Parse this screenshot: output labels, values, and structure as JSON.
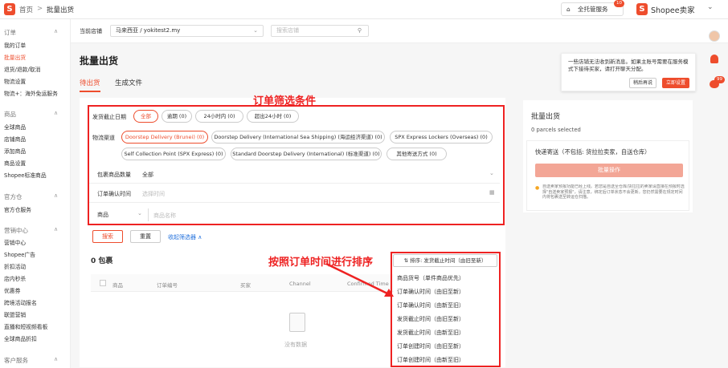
{
  "topbar": {
    "home": "首页",
    "sep": ">",
    "page": "批量出货",
    "managed": "全托管服务",
    "badge": "10",
    "seller": "Shopee卖家"
  },
  "sidebar": {
    "groups": [
      {
        "label": "订单",
        "items": [
          "我的订单",
          "批量出货",
          "退货/退款/取消",
          "物流设置",
          "物流+：海外免运服务"
        ]
      },
      {
        "label": "商品",
        "items": [
          "全球商品",
          "店铺商品",
          "添加商品",
          "商品设置",
          "Shopee标准商品"
        ]
      },
      {
        "label": "官方仓",
        "items": [
          "官方仓服务"
        ]
      },
      {
        "label": "营销中心",
        "items": [
          "营销中心",
          "Shopee广告",
          "折扣活动",
          "店内秒杀",
          "优惠券",
          "跨境活动报名",
          "联盟营销",
          "直播和短视频看板",
          "全球商品折扣"
        ]
      },
      {
        "label": "客户服务",
        "items": []
      }
    ]
  },
  "store": {
    "label": "当前店铺",
    "value": "马来西亚 / yokitest2.my",
    "search_placeholder": "搜索店铺"
  },
  "page": {
    "title": "批量出货",
    "tabs": [
      "待出货",
      "生成文件"
    ]
  },
  "filters": {
    "ship_deadline_label": "发货截止日期",
    "ship_deadline_opts": [
      "全部",
      "逾期 (0)",
      "24小时内 (0)",
      "超出24小时 (0)"
    ],
    "channel_label": "物流渠道",
    "channels_row1": [
      "Doorstep Delivery (Brunei) (0)",
      "Doorstep Delivery (International Sea Shipping) (海运经济渠道) (0)",
      "SPX Express Lockers (Overseas) (0)"
    ],
    "channels_row2": [
      "Self Collection Point (SPX Express) (0)",
      "Standard Doorstep Delivery (International) (标准渠道) (0)",
      "其他寄送方式 (0)"
    ],
    "qty_label": "包裹商品数量",
    "qty_value": "全部",
    "confirm_label": "订单确认时间",
    "confirm_placeholder": "选择时间",
    "product_select": "商品",
    "product_placeholder": "商品名称",
    "search_btn": "搜索",
    "reset_btn": "重置",
    "collapse": "收起筛选器 ∧"
  },
  "list": {
    "count": "0 包裹",
    "sort_label": "排序: 发货截止时间（由旧至新）",
    "columns": [
      "商品",
      "订单编号",
      "买家",
      "Channel",
      "Confirmed Time"
    ],
    "empty": "没有数据"
  },
  "sort_options": [
    "商品货号（单件商品优先）",
    "订单确认时间（由旧至新）",
    "订单确认时间（由新至旧）",
    "发货截止时间（由旧至新）",
    "发货截止时间（由新至旧）",
    "订单创建时间（由旧至新）",
    "订单创建时间（由新至旧）"
  ],
  "annotations": {
    "filter": "订单筛选条件",
    "sort": "按照订单时间进行排序"
  },
  "right_panel": {
    "title": "批量出货",
    "selected": "0 parcels selected",
    "express": "快递寄送（不包括: 货拉拉卖家，自送仓库）",
    "action": "批量操作",
    "note": "自送卖家预报功能已经上线。若您是自送至仓库/货拉拉的卖家请直接在预报时选择\"自送卖家预报\"，请注意，绑定后订单状态不会更新。您仍然需要在规定时间内将包裹送至转运仓扫描。"
  },
  "notif": {
    "text": "一些店铺无法收到新消息。如果主账号需要在服务模式下接待买家，请打开聊天分配。",
    "later": "稍后再说",
    "now": "立即设置"
  },
  "colors": {
    "accent": "#ee4d2d",
    "annotation": "#e22"
  }
}
